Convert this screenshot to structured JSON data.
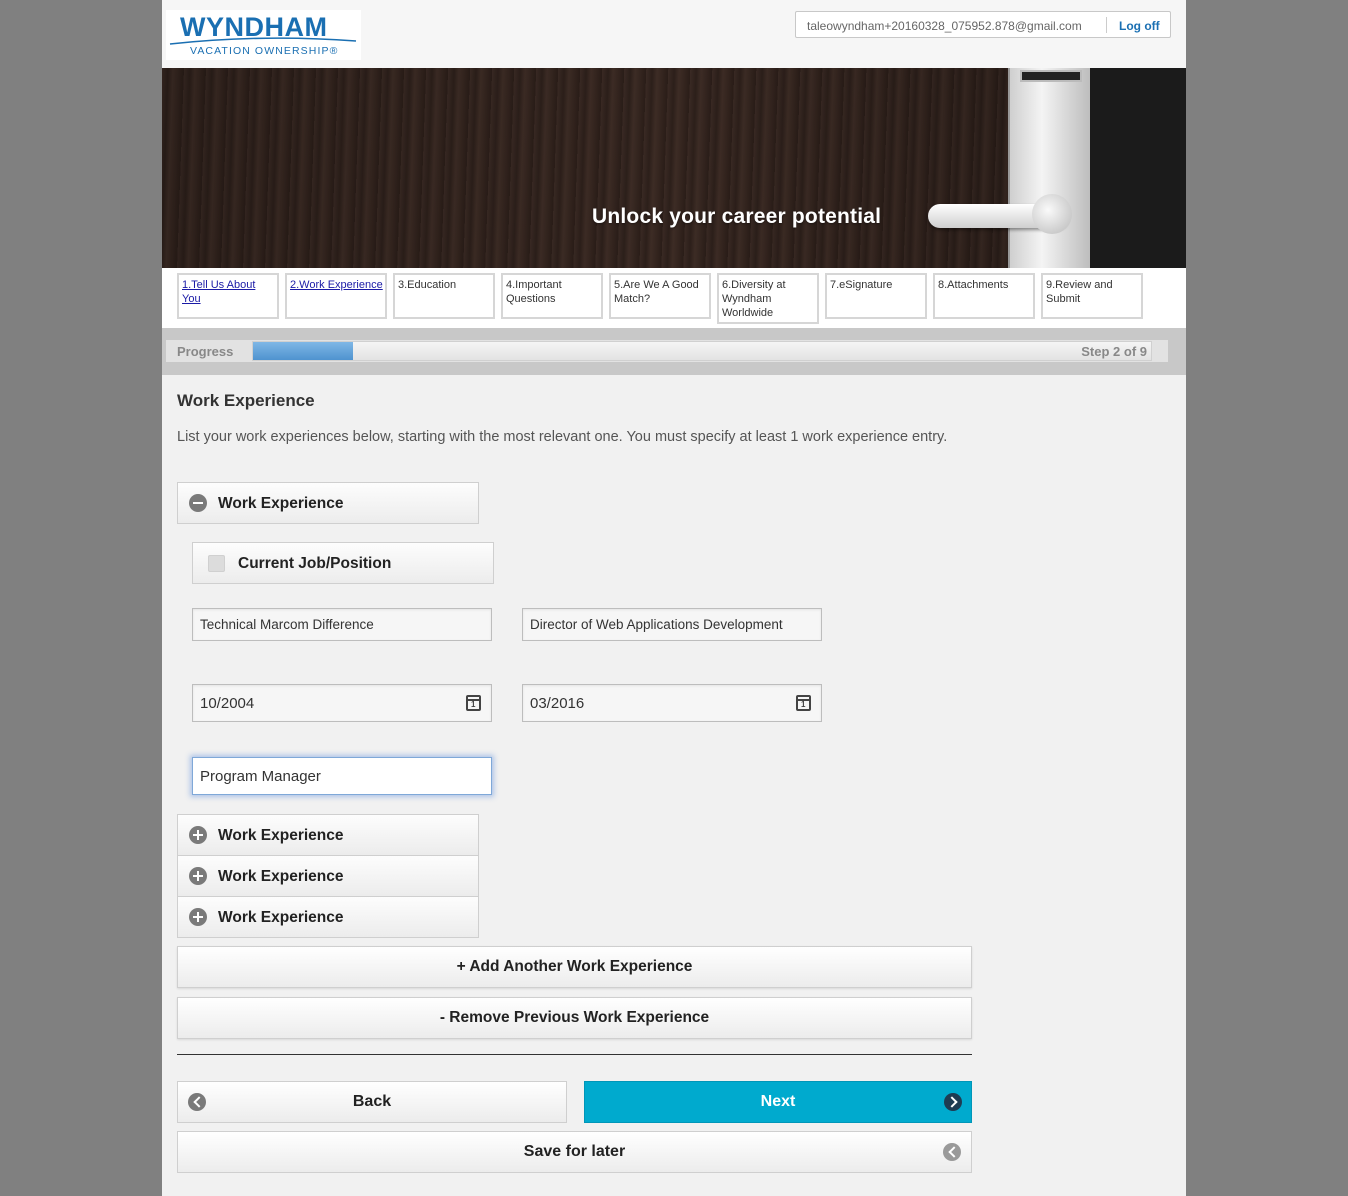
{
  "header": {
    "logo_main": "WYNDHAM",
    "logo_sub": "VACATION OWNERSHIP®",
    "user_email": "taleowyndham+20160328_075952.878@gmail.com",
    "logoff_label": "Log off"
  },
  "banner": {
    "tagline": "Unlock your career potential"
  },
  "steps": [
    {
      "label": "1.Tell Us About You",
      "link": true
    },
    {
      "label": "2.Work Experience",
      "link": true
    },
    {
      "label": "3.Education",
      "link": false
    },
    {
      "label": "4.Important Questions",
      "link": false
    },
    {
      "label": "5.Are We A Good Match?",
      "link": false
    },
    {
      "label": "6.Diversity at Wyndham Worldwide",
      "link": false
    },
    {
      "label": "7.eSignature",
      "link": false
    },
    {
      "label": "8.Attachments",
      "link": false
    },
    {
      "label": "9.Review and Submit",
      "link": false
    }
  ],
  "progress": {
    "label": "Progress",
    "step_text": "Step 2 of 9",
    "fraction": 0.111
  },
  "section": {
    "title": "Work Experience",
    "intro": "List your work experiences below, starting with the most relevant one. You must specify at least 1 work experience entry."
  },
  "experience_open": {
    "header": "Work Experience",
    "current_job_label": "Current Job/Position",
    "employer": "Technical Marcom Difference",
    "job_title": "Director of Web Applications Development",
    "start_date": "10/2004",
    "end_date": "03/2016",
    "last_field": "Program Manager"
  },
  "experience_collapsed": [
    "Work Experience",
    "Work Experience",
    "Work Experience"
  ],
  "buttons": {
    "add": "+ Add Another Work Experience",
    "remove": "- Remove Previous Work Experience",
    "back": "Back",
    "next": "Next",
    "save": "Save for later"
  },
  "colors": {
    "brand_blue": "#1a6fb2",
    "next_button": "#00aace",
    "progress_fill": "#4f93cf"
  }
}
